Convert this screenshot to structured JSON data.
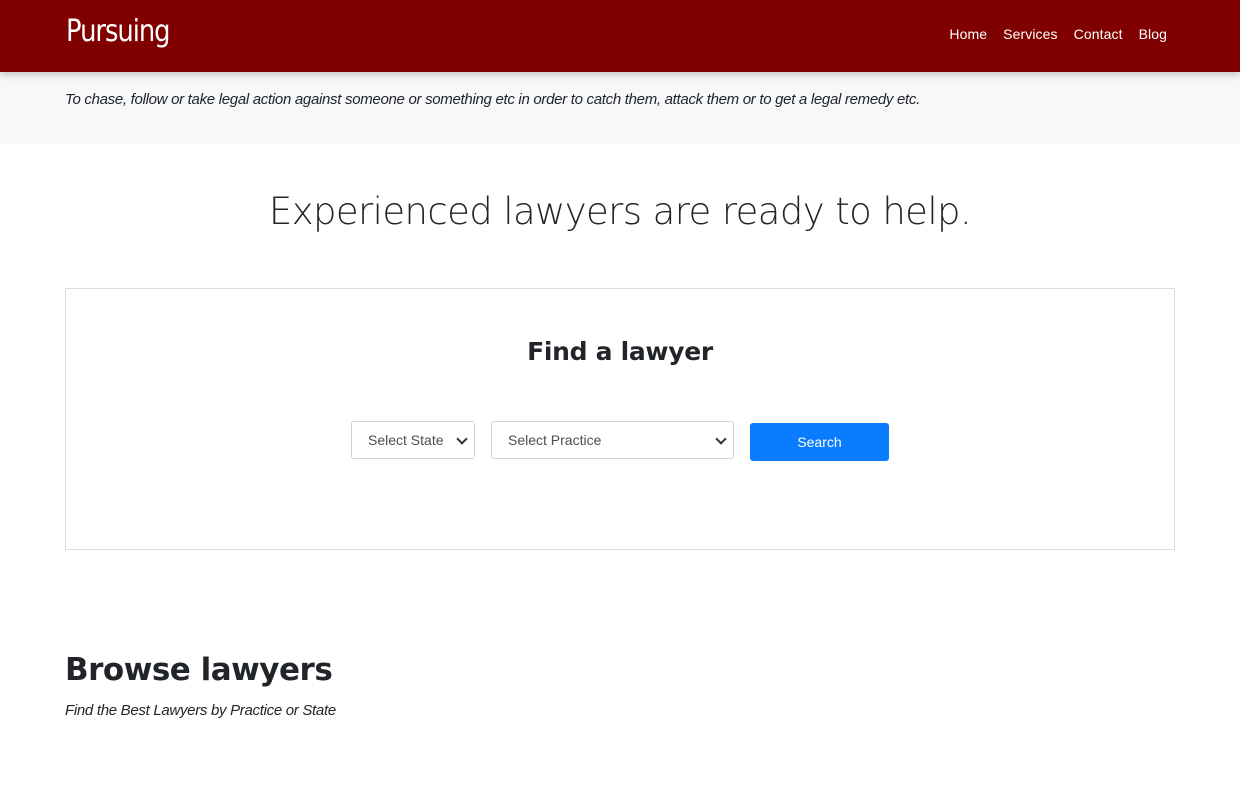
{
  "header": {
    "brand": "Pursuing",
    "nav": [
      {
        "label": "Home"
      },
      {
        "label": "Services"
      },
      {
        "label": "Contact"
      },
      {
        "label": "Blog"
      }
    ]
  },
  "tagline": "To chase, follow or take legal action against someone or something etc in order to catch them, attack them or to get a legal remedy etc.",
  "hero": {
    "title": "Experienced lawyers are ready to help."
  },
  "search": {
    "title": "Find a lawyer",
    "state_select": "Select State",
    "practice_select": "Select Practice",
    "button_label": "Search"
  },
  "browse": {
    "title": "Browse lawyers",
    "subtitle": "Find the Best Lawyers by Practice or State"
  },
  "colors": {
    "navbar": "#800000",
    "band": "#f7f8fa",
    "primary_button": "#0a7cff"
  }
}
